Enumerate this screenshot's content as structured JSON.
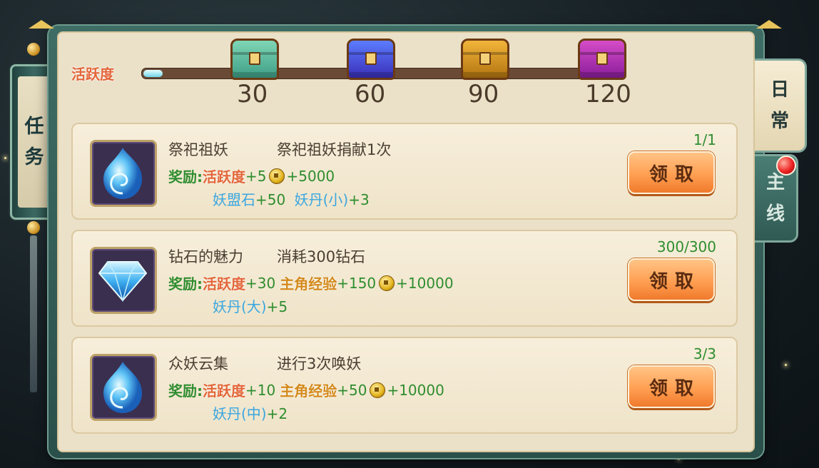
{
  "side_tab": {
    "chars": [
      "任",
      "务"
    ]
  },
  "header": {
    "activity_label": "活跃度",
    "progress_fraction": 0.04,
    "milestones": [
      {
        "value": "30",
        "chest": "green-chest-icon",
        "color": "#7fd6b5",
        "color2": "#3e9e86"
      },
      {
        "value": "60",
        "chest": "blue-chest-icon",
        "color": "#5c7cff",
        "color2": "#3a2fb8"
      },
      {
        "value": "90",
        "chest": "gold-chest-icon",
        "color": "#f2b53a",
        "color2": "#b27410"
      },
      {
        "value": "120",
        "chest": "purple-chest-icon",
        "color": "#d64cc8",
        "color2": "#8a1d9a"
      }
    ]
  },
  "tasks": [
    {
      "name": "祭祀祖妖",
      "desc": "祭祀祖妖捐献1次",
      "progress": "1/1",
      "icon": "blue-swirl-icon",
      "reward_label": "奖励:",
      "line1": {
        "activity_label": "活跃度",
        "activity": "+5",
        "exp_label": "",
        "exp": "",
        "coin": "+5000"
      },
      "line2": {
        "item1": "妖盟石",
        "val1": "+50",
        "item2": "妖丹(小)",
        "val2": "+3"
      },
      "button": "领取"
    },
    {
      "name": "钻石的魅力",
      "desc": "消耗300钻石",
      "progress": "300/300",
      "icon": "diamond-icon",
      "reward_label": "奖励:",
      "line1": {
        "activity_label": "活跃度",
        "activity": "+30",
        "exp_label": "主角经验",
        "exp": "+150",
        "coin": "+10000"
      },
      "line2": {
        "item1": "妖丹(大)",
        "val1": "+5",
        "item2": "",
        "val2": ""
      },
      "button": "领取"
    },
    {
      "name": "众妖云集",
      "desc": "进行3次唤妖",
      "progress": "3/3",
      "icon": "blue-swirl-icon",
      "reward_label": "奖励:",
      "line1": {
        "activity_label": "活跃度",
        "activity": "+10",
        "exp_label": "主角经验",
        "exp": "+50",
        "coin": "+10000"
      },
      "line2": {
        "item1": "妖丹(中)",
        "val1": "+2",
        "item2": "",
        "val2": ""
      },
      "button": "领取"
    }
  ],
  "right_tabs": {
    "daily": [
      "日",
      "常"
    ],
    "main": [
      "主",
      "线"
    ]
  }
}
